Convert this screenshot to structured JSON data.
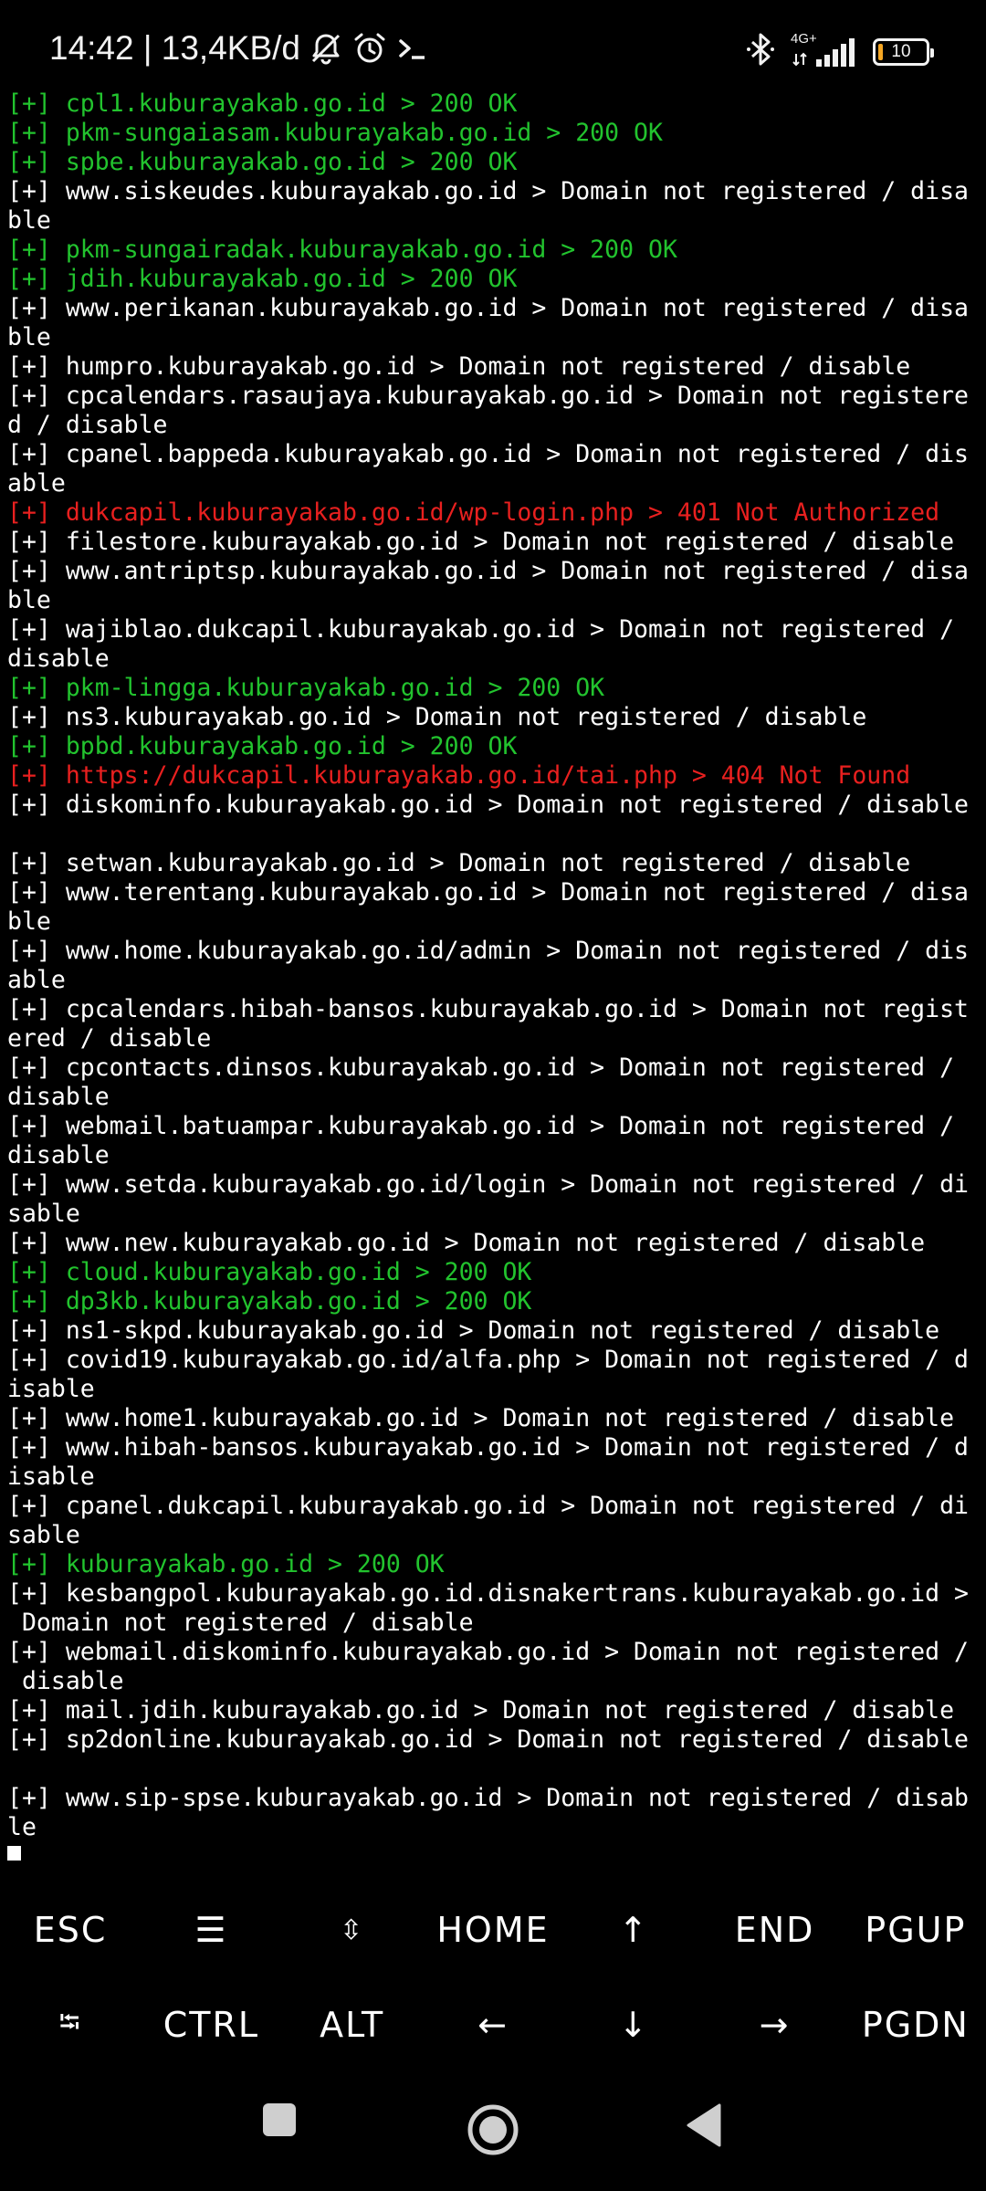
{
  "status_bar": {
    "left_text": "14:42 | 13,4KB/d",
    "network_label": "4G+",
    "battery_level": "10",
    "icons": [
      "dnd-bell-off-icon",
      "alarm-clock-icon",
      "terminal-prompt-icon",
      "bluetooth-icon",
      "signal-bars-icon",
      "battery-icon"
    ]
  },
  "colors": {
    "ok": "#22c32e",
    "error": "#e8201f",
    "default": "#ffffff",
    "battery_fill": "#f5a623"
  },
  "terminal": {
    "lines": [
      {
        "text": "[+] cpl1.kuburayakab.go.id > 200 OK",
        "status": "ok"
      },
      {
        "text": "[+] pkm-sungaiasam.kuburayakab.go.id > 200 OK",
        "status": "ok"
      },
      {
        "text": "[+] spbe.kuburayakab.go.id > 200 OK",
        "status": "ok"
      },
      {
        "text": "[+] www.siskeudes.kuburayakab.go.id > Domain not registered / disa",
        "status": "default"
      },
      {
        "text": "ble",
        "status": "default"
      },
      {
        "text": "[+] pkm-sungairadak.kuburayakab.go.id > 200 OK",
        "status": "ok"
      },
      {
        "text": "[+] jdih.kuburayakab.go.id > 200 OK",
        "status": "ok"
      },
      {
        "text": "[+] www.perikanan.kuburayakab.go.id > Domain not registered / disa",
        "status": "default"
      },
      {
        "text": "ble",
        "status": "default"
      },
      {
        "text": "[+] humpro.kuburayakab.go.id > Domain not registered / disable",
        "status": "default"
      },
      {
        "text": "[+] cpcalendars.rasaujaya.kuburayakab.go.id > Domain not registere",
        "status": "default"
      },
      {
        "text": "d / disable",
        "status": "default"
      },
      {
        "text": "[+] cpanel.bappeda.kuburayakab.go.id > Domain not registered / dis",
        "status": "default"
      },
      {
        "text": "able",
        "status": "default"
      },
      {
        "text": "[+] dukcapil.kuburayakab.go.id/wp-login.php > 401 Not Authorized",
        "status": "error"
      },
      {
        "text": "[+] filestore.kuburayakab.go.id > Domain not registered / disable",
        "status": "default"
      },
      {
        "text": "[+] www.antriptsp.kuburayakab.go.id > Domain not registered / disa",
        "status": "default"
      },
      {
        "text": "ble",
        "status": "default"
      },
      {
        "text": "[+] wajiblao.dukcapil.kuburayakab.go.id > Domain not registered /",
        "status": "default"
      },
      {
        "text": "disable",
        "status": "default"
      },
      {
        "text": "[+] pkm-lingga.kuburayakab.go.id > 200 OK",
        "status": "ok"
      },
      {
        "text": "[+] ns3.kuburayakab.go.id > Domain not registered / disable",
        "status": "default"
      },
      {
        "text": "[+] bpbd.kuburayakab.go.id > 200 OK",
        "status": "ok"
      },
      {
        "text": "[+] https://dukcapil.kuburayakab.go.id/tai.php > 404 Not Found",
        "status": "error"
      },
      {
        "text": "[+] diskominfo.kuburayakab.go.id > Domain not registered / disable",
        "status": "default"
      },
      {
        "text": "",
        "status": "default"
      },
      {
        "text": "[+] setwan.kuburayakab.go.id > Domain not registered / disable",
        "status": "default"
      },
      {
        "text": "[+] www.terentang.kuburayakab.go.id > Domain not registered / disa",
        "status": "default"
      },
      {
        "text": "ble",
        "status": "default"
      },
      {
        "text": "[+] www.home.kuburayakab.go.id/admin > Domain not registered / dis",
        "status": "default"
      },
      {
        "text": "able",
        "status": "default"
      },
      {
        "text": "[+] cpcalendars.hibah-bansos.kuburayakab.go.id > Domain not regist",
        "status": "default"
      },
      {
        "text": "ered / disable",
        "status": "default"
      },
      {
        "text": "[+] cpcontacts.dinsos.kuburayakab.go.id > Domain not registered /",
        "status": "default"
      },
      {
        "text": "disable",
        "status": "default"
      },
      {
        "text": "[+] webmail.batuampar.kuburayakab.go.id > Domain not registered /",
        "status": "default"
      },
      {
        "text": "disable",
        "status": "default"
      },
      {
        "text": "[+] www.setda.kuburayakab.go.id/login > Domain not registered / di",
        "status": "default"
      },
      {
        "text": "sable",
        "status": "default"
      },
      {
        "text": "[+] www.new.kuburayakab.go.id > Domain not registered / disable",
        "status": "default"
      },
      {
        "text": "[+] cloud.kuburayakab.go.id > 200 OK",
        "status": "ok"
      },
      {
        "text": "[+] dp3kb.kuburayakab.go.id > 200 OK",
        "status": "ok"
      },
      {
        "text": "[+] ns1-skpd.kuburayakab.go.id > Domain not registered / disable",
        "status": "default"
      },
      {
        "text": "[+] covid19.kuburayakab.go.id/alfa.php > Domain not registered / d",
        "status": "default"
      },
      {
        "text": "isable",
        "status": "default"
      },
      {
        "text": "[+] www.home1.kuburayakab.go.id > Domain not registered / disable",
        "status": "default"
      },
      {
        "text": "[+] www.hibah-bansos.kuburayakab.go.id > Domain not registered / d",
        "status": "default"
      },
      {
        "text": "isable",
        "status": "default"
      },
      {
        "text": "[+] cpanel.dukcapil.kuburayakab.go.id > Domain not registered / di",
        "status": "default"
      },
      {
        "text": "sable",
        "status": "default"
      },
      {
        "text": "[+] kuburayakab.go.id > 200 OK",
        "status": "ok"
      },
      {
        "text": "[+] kesbangpol.kuburayakab.go.id.disnakertrans.kuburayakab.go.id >",
        "status": "default"
      },
      {
        "text": " Domain not registered / disable",
        "status": "default"
      },
      {
        "text": "[+] webmail.diskominfo.kuburayakab.go.id > Domain not registered /",
        "status": "default"
      },
      {
        "text": " disable",
        "status": "default"
      },
      {
        "text": "[+] mail.jdih.kuburayakab.go.id > Domain not registered / disable",
        "status": "default"
      },
      {
        "text": "[+] sp2donline.kuburayakab.go.id > Domain not registered / disable",
        "status": "default"
      },
      {
        "text": "",
        "status": "default"
      },
      {
        "text": "[+] www.sip-spse.kuburayakab.go.id > Domain not registered / disab",
        "status": "default"
      },
      {
        "text": "le",
        "status": "default"
      }
    ]
  },
  "extra_keys": {
    "row1": [
      {
        "label": "ESC",
        "name": "key-esc"
      },
      {
        "label": "☰",
        "name": "key-menu",
        "icon": "hamburger-menu-icon"
      },
      {
        "label": "⇳",
        "name": "key-scroll",
        "icon": "up-down-arrow-icon"
      },
      {
        "label": "HOME",
        "name": "key-home"
      },
      {
        "label": "↑",
        "name": "key-up",
        "icon": "arrow-up-icon"
      },
      {
        "label": "END",
        "name": "key-end"
      },
      {
        "label": "PGUP",
        "name": "key-pgup"
      }
    ],
    "row2": [
      {
        "label": "⭾",
        "name": "key-tab",
        "icon": "tab-icon"
      },
      {
        "label": "CTRL",
        "name": "key-ctrl"
      },
      {
        "label": "ALT",
        "name": "key-alt"
      },
      {
        "label": "←",
        "name": "key-left",
        "icon": "arrow-left-icon"
      },
      {
        "label": "↓",
        "name": "key-down",
        "icon": "arrow-down-icon"
      },
      {
        "label": "→",
        "name": "key-right",
        "icon": "arrow-right-icon"
      },
      {
        "label": "PGDN",
        "name": "key-pgdn"
      }
    ]
  },
  "nav_bar": {
    "buttons": [
      "recents-square-icon",
      "home-circle-icon",
      "back-triangle-icon"
    ]
  }
}
